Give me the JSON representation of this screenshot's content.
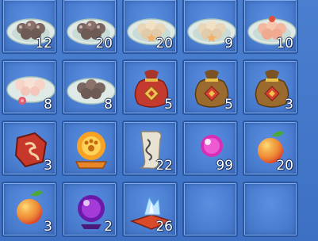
{
  "inventory": {
    "slots": [
      {
        "item": "dumplings-plate-dark",
        "count": "12"
      },
      {
        "item": "dumplings-plate-dark",
        "count": "20"
      },
      {
        "item": "dumplings-plate-flower",
        "count": "20"
      },
      {
        "item": "dumplings-plate-flower",
        "count": "9"
      },
      {
        "item": "dumplings-plate-red",
        "count": "10"
      },
      {
        "item": "dumplings-plate-pink",
        "count": "8"
      },
      {
        "item": "dumplings-plate-dark",
        "count": "8"
      },
      {
        "item": "red-pouch",
        "count": "5"
      },
      {
        "item": "brown-pouch",
        "count": "5"
      },
      {
        "item": "brown-pouch",
        "count": "3"
      },
      {
        "item": "red-rune-stone",
        "count": "3"
      },
      {
        "item": "golden-paw-orb",
        "count": ""
      },
      {
        "item": "paper-talisman",
        "count": "22"
      },
      {
        "item": "pink-pearl",
        "count": "99"
      },
      {
        "item": "peach",
        "count": "20"
      },
      {
        "item": "peach",
        "count": "3"
      },
      {
        "item": "purple-crystal-ball",
        "count": "2"
      },
      {
        "item": "ice-crystal-on-cushion",
        "count": "26"
      },
      {
        "item": "empty",
        "count": ""
      },
      {
        "item": "empty",
        "count": ""
      }
    ]
  }
}
